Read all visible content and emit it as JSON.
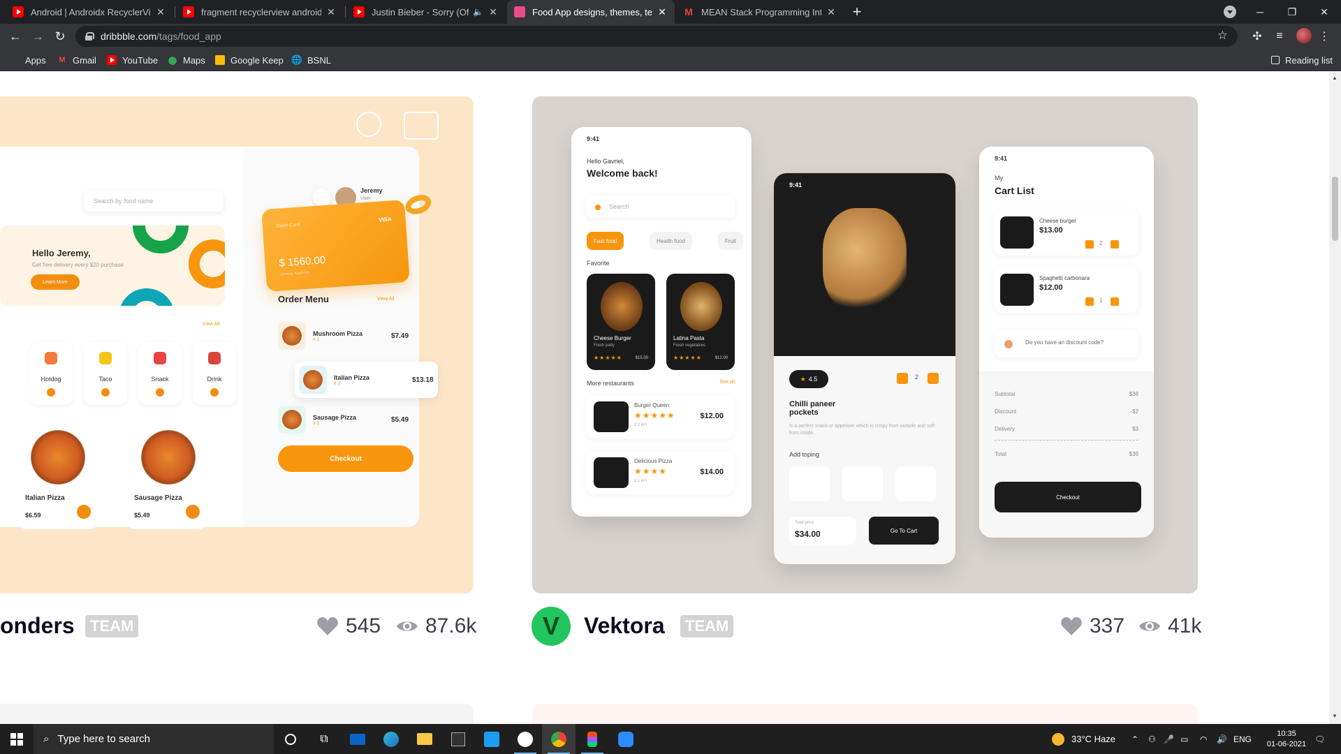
{
  "browser": {
    "tabs": [
      {
        "title": "Android | Androidx RecyclerView",
        "favicon": "youtube-icon",
        "active": false
      },
      {
        "title": "fragment recyclerview android o",
        "favicon": "youtube-icon",
        "active": false
      },
      {
        "title": "Justin Bieber - Sorry (Official",
        "favicon": "youtube-icon",
        "active": false,
        "audio": true
      },
      {
        "title": "Food App designs, themes, temp",
        "favicon": "dribbble-icon",
        "active": true
      },
      {
        "title": "MEAN Stack Programming Interr",
        "favicon": "gmail-icon",
        "active": false
      }
    ],
    "url": {
      "host": "dribbble.com",
      "path": "/tags/food_app"
    },
    "bookmarks": [
      {
        "label": "Apps",
        "icon": "apps-grid-icon"
      },
      {
        "label": "Gmail",
        "icon": "gmail-icon"
      },
      {
        "label": "YouTube",
        "icon": "youtube-icon"
      },
      {
        "label": "Maps",
        "icon": "maps-icon"
      },
      {
        "label": "Google Keep",
        "icon": "keep-icon"
      },
      {
        "label": "BSNL",
        "icon": "globe-icon"
      }
    ],
    "reading_list": "Reading list"
  },
  "shots": [
    {
      "author": "onders",
      "badge": "TEAM",
      "likes": "545",
      "views": "87.6k",
      "mockup": {
        "search_placeholder": "Search by food name",
        "user_name": "Jeremy",
        "user_role": "User",
        "hello_title": "Hello Jeremy,",
        "hello_sub": "Get free delivery every $20 purchase",
        "learn_more": "Learn More",
        "view_all": "View All",
        "card_label": "Debit Card",
        "card_brand": "VISA",
        "card_amount": "$ 1560.00",
        "card_holder": "Jeremy Mathew",
        "categories": [
          "Hotdog",
          "Taco",
          "Snack",
          "Drink"
        ],
        "pizzas": [
          {
            "name": "Italian Pizza",
            "price": "$6.59"
          },
          {
            "name": "Sausage Pizza",
            "price": "$5.49"
          }
        ],
        "order_menu_title": "Order Menu",
        "order_items": [
          {
            "name": "Mushroom Pizza",
            "qty": "x 1",
            "price": "$7.49"
          },
          {
            "name": "Italian Pizza",
            "qty": "x 2",
            "price": "$13.18"
          },
          {
            "name": "Sausage Pizza",
            "qty": "x 1",
            "price": "$5.49"
          }
        ],
        "checkout": "Checkout"
      }
    },
    {
      "author": "Vektora",
      "avatar_letter": "V",
      "badge": "TEAM",
      "likes": "337",
      "views": "41k",
      "mockup": {
        "time": "9:41",
        "greeting": "Hello Gavriel,",
        "welcome": "Welcome back!",
        "search": "Search",
        "chips": [
          "Fast food",
          "Health food",
          "Fruit"
        ],
        "favorite_label": "Favorite",
        "favorites": [
          {
            "name": "Cheese Burger",
            "sub": "Fresh patty",
            "price": "$15.00"
          },
          {
            "name": "Latina Pasta",
            "sub": "Fresh vegetables",
            "price": "$12.00"
          }
        ],
        "more_restaurants": "More restaurants",
        "see_all": "See all",
        "restaurants": [
          {
            "name": "Burger Queen",
            "dist": "2.2 km",
            "price": "$12.00"
          },
          {
            "name": "Delicious Pizza",
            "dist": "3.1 km",
            "price": "$14.00"
          }
        ],
        "rating": "4.5",
        "qty": "2",
        "dish_name": "Chilli paneer pockets",
        "dish_desc": "Is a perfect snack or appetizer which is crispy from outside and soft from inside.",
        "add_toping": "Add toping",
        "total_price_label": "Total price",
        "total_price": "$34.00",
        "go_to_cart": "Go To Cart",
        "cart_title_1": "My",
        "cart_title_2": "Cart List",
        "cart_items": [
          {
            "name": "Cheese burger",
            "price": "$13.00",
            "qty": "2"
          },
          {
            "name": "Spaghetti carbonara",
            "price": "$12.00",
            "qty": "1"
          }
        ],
        "discount_prompt": "Do you have an discount code?",
        "summary": [
          {
            "label": "Subtotal",
            "value": "$38"
          },
          {
            "label": "Discount",
            "value": "-$2"
          },
          {
            "label": "Delivery",
            "value": "$3"
          },
          {
            "label": "Total",
            "value": "$39"
          }
        ],
        "checkout": "Checkout"
      }
    }
  ],
  "taskbar": {
    "search_placeholder": "Type here to search",
    "weather": "33°C  Haze",
    "language": "ENG",
    "time": "10:35",
    "date": "01-06-2021"
  },
  "colors": {
    "accent": "#f7960d",
    "dribbble_pink": "#ea4c89",
    "vektora_green": "#22c55e"
  }
}
